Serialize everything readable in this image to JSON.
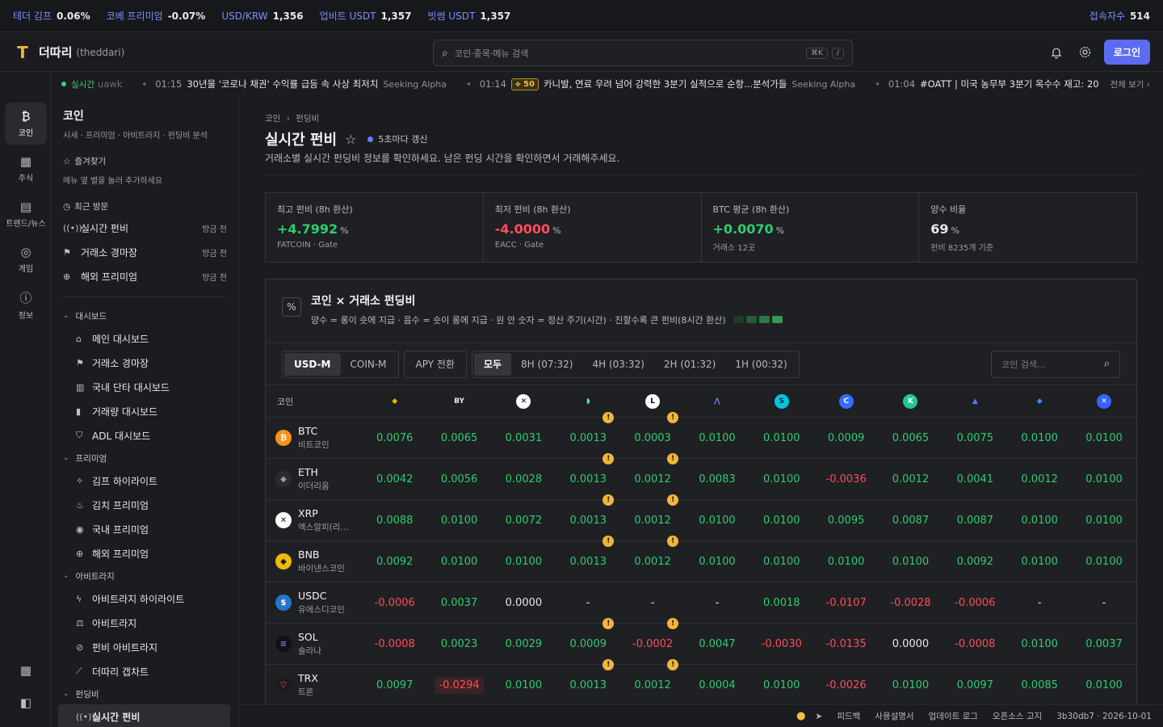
{
  "ticker": [
    {
      "label": "테더 김프",
      "value": "0.06%"
    },
    {
      "label": "코베 프리미엄",
      "value": "-0.07%"
    },
    {
      "label": "USD/KRW",
      "value": "1,356"
    },
    {
      "label": "업비트 USDT",
      "value": "1,357"
    },
    {
      "label": "빗썸 USDT",
      "value": "1,357"
    }
  ],
  "users": {
    "label": "접속자수",
    "value": "514"
  },
  "header": {
    "brand": "더따리",
    "brand_sub": "(theddari)",
    "search_placeholder": "코인·종목·메뉴 검색",
    "kbd1": "⌘K",
    "kbd2": "/",
    "login": "로그인"
  },
  "news": {
    "live": "실시간",
    "items": [
      {
        "time": "",
        "text": "uawk",
        "source": ""
      },
      {
        "time": "01:15",
        "text": "30년물 '코로나 채권' 수익률 급등 속 사상 최저치",
        "source": "Seeking Alpha"
      },
      {
        "time": "01:14",
        "badge": "50",
        "text": "카니발, 연료 우려 넘어 강력한 3분기 실적으로 순항...분석가들",
        "source": "Seeking Alpha"
      },
      {
        "time": "01:04",
        "text": "#OATT | 미국 농무부 3분기 옥수수 재고: 20",
        "source": ""
      }
    ],
    "more": "전체 보기 ›"
  },
  "rail": [
    {
      "icon": "₿",
      "label": "코인"
    },
    {
      "icon": "▦",
      "label": "주식"
    },
    {
      "icon": "▤",
      "label": "트렌드/뉴스"
    },
    {
      "icon": "◎",
      "label": "게임"
    },
    {
      "icon": "ⓘ",
      "label": "정보"
    }
  ],
  "sidebar": {
    "title": "코인",
    "subtitle": "시세 · 프리미엄 · 아비트라지 · 펀딩비 분석",
    "fav_title": "즐겨찾기",
    "fav_hint": "메뉴 옆 별을 눌러 추가하세요",
    "recent_title": "최근 방문",
    "recent": [
      {
        "label": "실시간 펀비",
        "time": "방금 전"
      },
      {
        "label": "거래소 경마장",
        "time": "방금 전"
      },
      {
        "label": "해외 프리미엄",
        "time": "방금 전"
      }
    ],
    "groups": [
      {
        "title": "대시보드",
        "items": [
          "메인 대시보드",
          "거래소 경마장",
          "국내 단타 대시보드",
          "거래량 대시보드",
          "ADL 대시보드"
        ]
      },
      {
        "title": "프리미엄",
        "items": [
          "김프 하이라이트",
          "김치 프리미엄",
          "국내 프리미엄",
          "해외 프리미엄"
        ]
      },
      {
        "title": "아비트라지",
        "items": [
          "아비트라지 하이라이트",
          "아비트라지",
          "펀비 아비트라지",
          "더따리 갭차트"
        ]
      },
      {
        "title": "펀딩비",
        "items": [
          "실시간 펀비"
        ]
      }
    ]
  },
  "page": {
    "crumb1": "코인",
    "crumb2": "펀딩비",
    "title": "실시간 펀비",
    "update": "5초마다 갱신",
    "desc": "거래소별 실시간 펀딩비 정보를 확인하세요. 남은 펀딩 시간을 확인하면서 거래해주세요."
  },
  "stats": [
    {
      "label": "최고 펀비 (8h 환산)",
      "value": "+4.7992",
      "unit": "%",
      "sub": "FATCOIN · Gate",
      "tone": "pos"
    },
    {
      "label": "최저 펀비 (8h 환산)",
      "value": "-4.0000",
      "unit": "%",
      "sub": "EACC · Gate",
      "tone": "neg"
    },
    {
      "label": "BTC 평균 (8h 환산)",
      "value": "+0.0070",
      "unit": "%",
      "sub": "거래소 12곳",
      "tone": "pos"
    },
    {
      "label": "양수 비율",
      "value": "69",
      "unit": "%",
      "sub": "펀비 8235개 기준",
      "tone": "neu"
    }
  ],
  "panel": {
    "title": "코인 × 거래소 펀딩비",
    "desc": "양수 = 롱이 숏에 지급 · 음수 = 숏이 롱에 지급 · 원 안 숫자 = 정산 주기(시간) · 진할수록 큰 펀비(8시간 환산)",
    "swatches": [
      "#1f3b2a",
      "#235c38",
      "#2a7a45",
      "#33994f"
    ],
    "seg1": [
      "USD-M",
      "COIN-M"
    ],
    "seg2": [
      "APY 전환"
    ],
    "seg3": [
      "모두",
      "8H (07:32)",
      "4H (03:32)",
      "2H (01:32)",
      "1H (00:32)"
    ],
    "coin_search": "코인 검색...",
    "col_coin": "코인"
  },
  "exchanges": [
    {
      "icon": "binance-icon",
      "glyph": "◆",
      "bg": "#1e1f22",
      "fg": "#f0b90b"
    },
    {
      "icon": "bybit-icon",
      "glyph": "BY",
      "bg": "#1e1f22",
      "fg": "#e6e7ea"
    },
    {
      "icon": "okx-icon",
      "glyph": "✕",
      "bg": "#ffffff",
      "fg": "#000000"
    },
    {
      "icon": "hyperliquid-icon",
      "glyph": "◗",
      "bg": "#1e1f22",
      "fg": "#5fe0c0"
    },
    {
      "icon": "lighter-icon",
      "glyph": "L",
      "bg": "#ffffff",
      "fg": "#000000"
    },
    {
      "icon": "aster-icon",
      "glyph": "⋀",
      "bg": "#1e1f22",
      "fg": "#6b8cff"
    },
    {
      "icon": "bitget-icon",
      "glyph": "S",
      "bg": "#00c4e0",
      "fg": "#0a2a30"
    },
    {
      "icon": "coinex-icon",
      "glyph": "C",
      "bg": "#3a6bff",
      "fg": "#ffffff"
    },
    {
      "icon": "kucoin-icon",
      "glyph": "K",
      "bg": "#25c49a",
      "fg": "#ffffff"
    },
    {
      "icon": "paradex-icon",
      "glyph": "▲",
      "bg": "#1e1f22",
      "fg": "#4f7bff"
    },
    {
      "icon": "drift-icon",
      "glyph": "◆",
      "bg": "#1e1f22",
      "fg": "#3d8bff"
    },
    {
      "icon": "gate-icon",
      "glyph": "✕",
      "bg": "#3a62ff",
      "fg": "#ffffff"
    }
  ],
  "rows": [
    {
      "sym": "BTC",
      "name": "비트코인",
      "icon": "₿",
      "bg": "#f7931a",
      "fg": "#fff",
      "vals": [
        "0.0076",
        "0.0065",
        "0.0031",
        "0.0013",
        "0.0003",
        "0.0100",
        "0.0100",
        "0.0009",
        "0.0065",
        "0.0075",
        "0.0100",
        "0.0100"
      ],
      "warn": [
        3,
        4
      ]
    },
    {
      "sym": "ETH",
      "name": "이더리움",
      "icon": "◆",
      "bg": "#2b2c31",
      "fg": "#9a9ca3",
      "vals": [
        "0.0042",
        "0.0056",
        "0.0028",
        "0.0013",
        "0.0012",
        "0.0083",
        "0.0100",
        "-0.0036",
        "0.0012",
        "0.0041",
        "0.0012",
        "0.0100"
      ],
      "warn": [
        3,
        4
      ]
    },
    {
      "sym": "XRP",
      "name": "엑스알피(리...",
      "icon": "✕",
      "bg": "#ffffff",
      "fg": "#1b1c1f",
      "vals": [
        "0.0088",
        "0.0100",
        "0.0072",
        "0.0013",
        "0.0012",
        "0.0100",
        "0.0100",
        "0.0095",
        "0.0087",
        "0.0087",
        "0.0100",
        "0.0100"
      ],
      "warn": [
        3,
        4
      ]
    },
    {
      "sym": "BNB",
      "name": "바이낸스코인",
      "icon": "◆",
      "bg": "#f0b90b",
      "fg": "#1b1c1f",
      "vals": [
        "0.0092",
        "0.0100",
        "0.0100",
        "0.0013",
        "0.0012",
        "0.0100",
        "0.0100",
        "0.0100",
        "0.0100",
        "0.0092",
        "0.0100",
        "0.0100"
      ],
      "warn": [
        3,
        4
      ]
    },
    {
      "sym": "USDC",
      "name": "유에스디코인",
      "icon": "$",
      "bg": "#2775ca",
      "fg": "#ffffff",
      "vals": [
        "-0.0006",
        "0.0037",
        "0.0000",
        "-",
        "-",
        "-",
        "0.0018",
        "-0.0107",
        "-0.0028",
        "-0.0006",
        "-",
        "-"
      ],
      "warn": []
    },
    {
      "sym": "SOL",
      "name": "솔라나",
      "icon": "≡",
      "bg": "#111111",
      "fg": "#9c6cff",
      "vals": [
        "-0.0008",
        "0.0023",
        "0.0029",
        "0.0009",
        "-0.0002",
        "0.0047",
        "-0.0030",
        "-0.0135",
        "0.0000",
        "-0.0008",
        "0.0100",
        "0.0037"
      ],
      "warn": [
        3,
        4
      ]
    },
    {
      "sym": "TRX",
      "name": "트론",
      "icon": "▽",
      "bg": "#1b1c1f",
      "fg": "#ff3d3d",
      "vals": [
        "0.0097",
        "-0.0294",
        "0.0100",
        "0.0013",
        "0.0012",
        "0.0004",
        "0.0100",
        "-0.0026",
        "0.0100",
        "0.0097",
        "0.0085",
        "0.0100"
      ],
      "warn": [
        3,
        4
      ],
      "hl": [
        1
      ]
    }
  ],
  "warn_glyph": "!",
  "footer": [
    "피드백",
    "사용설명서",
    "업데이트 로그",
    "오픈소스 고지",
    "3b30db7 · 2026-10-01"
  ]
}
